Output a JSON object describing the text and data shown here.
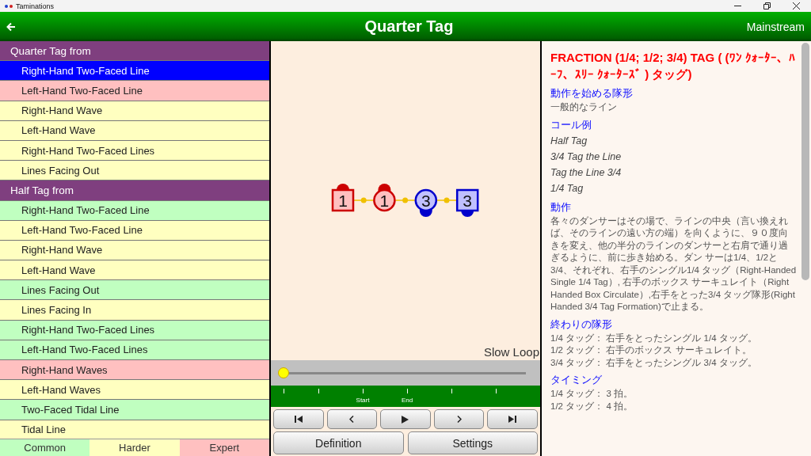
{
  "window": {
    "title": "Taminations"
  },
  "header": {
    "title": "Quarter Tag",
    "level": "Mainstream"
  },
  "formations": [
    {
      "kind": "group",
      "label": "Quarter Tag from"
    },
    {
      "kind": "item",
      "label": "Right-Hand Two-Faced Line",
      "selected": true
    },
    {
      "kind": "item",
      "label": "Left-Hand Two-Faced Line",
      "selected": false,
      "color": "#ffc0c0"
    },
    {
      "kind": "item",
      "label": "Right-Hand Wave",
      "selected": false,
      "color": "#ffffc0"
    },
    {
      "kind": "item",
      "label": "Left-Hand Wave",
      "selected": false,
      "color": "#ffffc0"
    },
    {
      "kind": "item",
      "label": "Right-Hand Two-Faced Lines",
      "selected": false,
      "color": "#ffffc0"
    },
    {
      "kind": "item",
      "label": "Lines Facing Out",
      "selected": false,
      "color": "#ffffc0"
    },
    {
      "kind": "group",
      "label": "Half Tag from"
    },
    {
      "kind": "item",
      "label": "Right-Hand Two-Faced Line",
      "selected": false,
      "color": "#c0ffc0"
    },
    {
      "kind": "item",
      "label": "Left-Hand Two-Faced Line",
      "selected": false,
      "color": "#ffffc0"
    },
    {
      "kind": "item",
      "label": "Right-Hand Wave",
      "selected": false,
      "color": "#ffffc0"
    },
    {
      "kind": "item",
      "label": "Left-Hand Wave",
      "selected": false,
      "color": "#ffffc0"
    },
    {
      "kind": "item",
      "label": "Lines Facing Out",
      "selected": false,
      "color": "#c0ffc0"
    },
    {
      "kind": "item",
      "label": "Lines Facing In",
      "selected": false,
      "color": "#ffffc0"
    },
    {
      "kind": "item",
      "label": "Right-Hand Two-Faced Lines",
      "selected": false,
      "color": "#c0ffc0"
    },
    {
      "kind": "item",
      "label": "Left-Hand Two-Faced Lines",
      "selected": false,
      "color": "#c0ffc0"
    },
    {
      "kind": "item",
      "label": "Right-Hand Waves",
      "selected": false,
      "color": "#ffc0c0"
    },
    {
      "kind": "item",
      "label": "Left-Hand Waves",
      "selected": false,
      "color": "#ffffc0"
    },
    {
      "kind": "item",
      "label": "Two-Faced Tidal Line",
      "selected": false,
      "color": "#c0ffc0"
    },
    {
      "kind": "item",
      "label": "Tidal Line",
      "selected": false,
      "color": "#ffffc0"
    }
  ],
  "difficulty_tabs": [
    {
      "label": "Common",
      "color": "#c0ffc0"
    },
    {
      "label": "Harder",
      "color": "#ffffc0"
    },
    {
      "label": "Expert",
      "color": "#ffc0c0"
    }
  ],
  "animation": {
    "dancers": [
      {
        "kind": "square",
        "number": "1",
        "color": "#cc0000",
        "facing_up": true
      },
      {
        "kind": "circle",
        "number": "1",
        "color": "#cc0000",
        "facing_up": true
      },
      {
        "kind": "circle",
        "number": "3",
        "color": "#0000cc",
        "facing_up": false
      },
      {
        "kind": "square",
        "number": "3",
        "color": "#0000cc",
        "facing_up": false
      }
    ],
    "loop_label": "Slow Loop",
    "slider": {
      "level": 0
    },
    "timeline_labels": [
      "Start",
      "End"
    ],
    "playback_buttons": [
      {
        "kind": "first"
      },
      {
        "kind": "previous"
      },
      {
        "kind": "play"
      },
      {
        "kind": "next"
      },
      {
        "kind": "last"
      }
    ],
    "buttons": [
      "Definition",
      "Settings"
    ]
  },
  "definition": {
    "title": "FRACTION (1/4; 1/2; 3/4) TAG ( (ﾜﾝ ｸｫｰﾀｰ、ﾊｰﾌ、ｽﾘｰ ｸｫｰﾀｰｽﾞ ) タッグ)",
    "sections": [
      {
        "heading": "動作を始める隊形",
        "kind": "text",
        "lines": [
          "一般的なライン"
        ]
      },
      {
        "heading": "コール例",
        "kind": "examples",
        "lines": [
          "Half Tag",
          "3/4 Tag the Line",
          "Tag the Line 3/4",
          "1/4 Tag"
        ]
      },
      {
        "heading": "動作",
        "kind": "text",
        "lines": [
          "各々のダンサーはその場で、ラインの中央（言い換えれば、そのラインの遠い方の端）を向くように、９０度向きを変え、他の半分のラインのダンサーと右肩で通り過ぎるように、前に歩き始める。ダン サーは1/4、1/2と3/4、それぞれ、右手のシングル1/4 タッグ（Right-Handed Single 1/4 Tag）, 右手のボックス サーキュレイト（Right Handed Box Circulate）,右手をとった3/4 タッグ隊形(Right Handed 3/4 Tag Formation)で止まる。"
        ]
      },
      {
        "heading": "終わりの隊形",
        "kind": "text",
        "lines": [
          "1/4 タッグ： 右手をとったシングル 1/4 タッグ。",
          "1/2 タッグ： 右手のボックス サーキュレイト。",
          "3/4 タッグ： 右手をとったシングル 3/4 タッグ。"
        ]
      },
      {
        "heading": "タイミング",
        "kind": "text",
        "lines": [
          "1/4 タッグ： 3 拍。",
          "1/2 タッグ： 4 拍。"
        ]
      }
    ]
  }
}
